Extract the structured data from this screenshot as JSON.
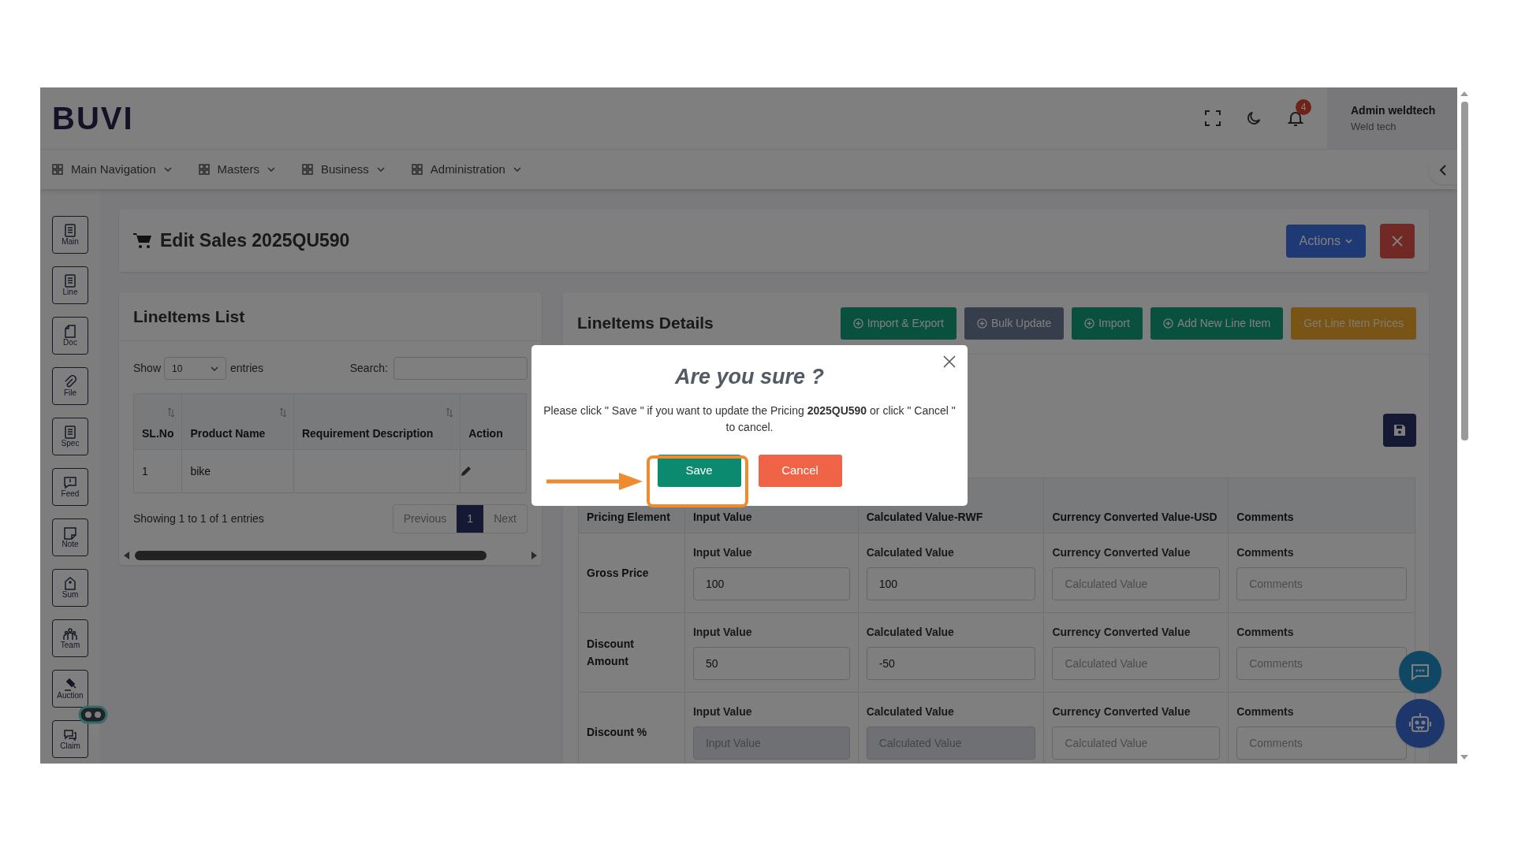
{
  "header": {
    "logo": "BUVI",
    "notification_count": "4",
    "user": {
      "name": "Admin weldtech",
      "company": "Weld tech"
    }
  },
  "nav": [
    {
      "label": "Main Navigation"
    },
    {
      "label": "Masters"
    },
    {
      "label": "Business"
    },
    {
      "label": "Administration"
    }
  ],
  "sidebar": [
    {
      "label": "Main"
    },
    {
      "label": "Line"
    },
    {
      "label": "Doc"
    },
    {
      "label": "File"
    },
    {
      "label": "Spec"
    },
    {
      "label": "Feed"
    },
    {
      "label": "Note"
    },
    {
      "label": "Sum"
    },
    {
      "label": "Team"
    },
    {
      "label": "Auction"
    },
    {
      "label": "Claim"
    }
  ],
  "page_header": {
    "title": "Edit Sales 2025QU590",
    "actions_button": "Actions"
  },
  "lineitems_list": {
    "title": "LineItems List",
    "show_label": "Show",
    "page_size": "10",
    "entries_label": "entries",
    "search_label": "Search:",
    "columns": [
      {
        "label": "SL.No",
        "sortable": true
      },
      {
        "label": "Product Name",
        "sortable": true
      },
      {
        "label": "Requirement Description",
        "sortable": true
      },
      {
        "label": "Action",
        "sortable": false
      }
    ],
    "rows": [
      {
        "sl_no": "1",
        "product_name": "bike"
      }
    ],
    "summary": "Showing 1 to 1 of 1 entries",
    "pagination": {
      "previous": "Previous",
      "pages": [
        {
          "label": "1",
          "selected": true
        }
      ],
      "next": "Next"
    }
  },
  "lineitems_details": {
    "title": "LineItems Details",
    "buttons": [
      {
        "label": "Import & Export",
        "kind": "import_export"
      },
      {
        "label": "Bulk Update",
        "kind": "bulk_update"
      },
      {
        "label": "Import",
        "kind": "import"
      },
      {
        "label": "Add New Line Item",
        "kind": "add"
      },
      {
        "label": "Get Line Item Prices",
        "kind": "prices"
      }
    ],
    "pricing_table": {
      "columns": [
        "Pricing Element",
        "Input Value",
        "Calculated Value-RWF",
        "Currency Converted Value-USD",
        "Comments"
      ],
      "rows": [
        {
          "element": "Gross Price",
          "fields": [
            {
              "label": "Input Value",
              "value": "100",
              "disabled": false
            },
            {
              "label": "Calculated Value",
              "value": "100",
              "disabled": false
            },
            {
              "label": "Currency Converted Value",
              "placeholder": "Calculated Value",
              "disabled": false
            },
            {
              "label": "Comments",
              "placeholder": "Comments",
              "disabled": false
            }
          ]
        },
        {
          "element": "Discount Amount",
          "fields": [
            {
              "label": "Input Value",
              "value": "50",
              "disabled": false
            },
            {
              "label": "Calculated Value",
              "value": "-50",
              "disabled": false
            },
            {
              "label": "Currency Converted Value",
              "placeholder": "Calculated Value",
              "disabled": false
            },
            {
              "label": "Comments",
              "placeholder": "Comments",
              "disabled": false
            }
          ]
        },
        {
          "element": "Discount %",
          "fields": [
            {
              "label": "Input Value",
              "placeholder": "Input Value",
              "disabled": true
            },
            {
              "label": "Calculated Value",
              "placeholder": "Calculated Value",
              "disabled": true
            },
            {
              "label": "Currency Converted Value",
              "placeholder": "Calculated Value",
              "disabled": false
            },
            {
              "label": "Comments",
              "placeholder": "Comments",
              "disabled": false
            }
          ]
        }
      ]
    }
  },
  "dialog": {
    "title": "Are you sure ?",
    "message": "Please click \" Save \" if you want to update the Pricing **2025QU590** or click \" Cancel \" to cancel.",
    "buttons": [
      {
        "label": "Save",
        "kind": "confirm"
      },
      {
        "label": "Cancel",
        "kind": "cancel"
      }
    ]
  }
}
